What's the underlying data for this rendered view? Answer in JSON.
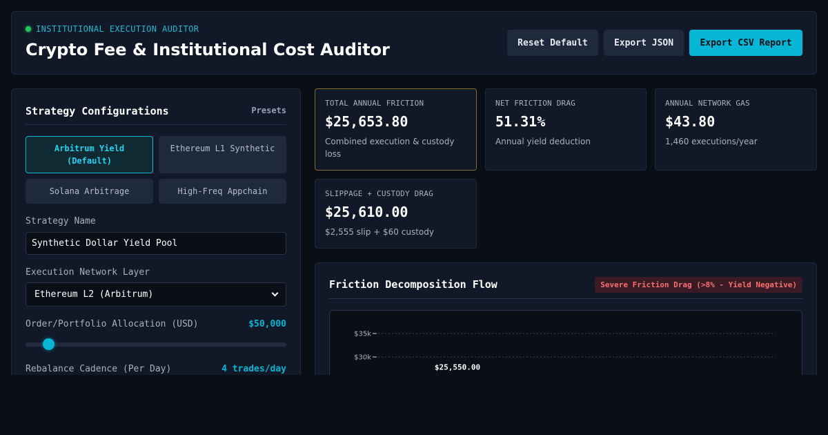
{
  "header": {
    "eyebrow": "INSTITUTIONAL EXECUTION AUDITOR",
    "title": "Crypto Fee & Institutional Cost Auditor",
    "buttons": {
      "reset": "Reset Default",
      "export_json": "Export JSON",
      "export_csv": "Export CSV Report"
    }
  },
  "config": {
    "title": "Strategy Configurations",
    "presets_label": "Presets",
    "presets": [
      {
        "label": "Arbitrum Yield (Default)",
        "active": true
      },
      {
        "label": "Ethereum L1 Synthetic",
        "active": false
      },
      {
        "label": "Solana Arbitrage",
        "active": false
      },
      {
        "label": "High-Freq Appchain",
        "active": false
      }
    ],
    "strategy_name_label": "Strategy Name",
    "strategy_name_value": "Synthetic Dollar Yield Pool",
    "network_label": "Execution Network Layer",
    "network_value": "Ethereum L2 (Arbitrum)",
    "allocation_label": "Order/Portfolio Allocation (USD)",
    "allocation_value": "$50,000",
    "allocation_fraction": 0.07,
    "cadence_label": "Rebalance Cadence (Per Day)",
    "cadence_value": "4 trades/day"
  },
  "metrics": [
    {
      "label": "TOTAL ANNUAL FRICTION",
      "value": "$25,653.80",
      "sub": "Combined execution & custody loss",
      "highlight": true
    },
    {
      "label": "NET FRICTION DRAG",
      "value": "51.31%",
      "sub": "Annual yield deduction",
      "highlight": false
    },
    {
      "label": "ANNUAL NETWORK GAS",
      "value": "$43.80",
      "sub": "1,460 executions/year",
      "highlight": false
    },
    {
      "label": "SLIPPAGE + CUSTODY DRAG",
      "value": "$25,610.00",
      "sub": "$2,555 slip + $60 custody",
      "highlight": false
    }
  ],
  "flow": {
    "title": "Friction Decomposition Flow",
    "badge": "Severe Friction Drag (>8% - Yield Negative)",
    "badge_color": "#f87171"
  },
  "chart_data": {
    "type": "bar",
    "y_ticks": [
      "$35k",
      "$30k"
    ],
    "y_tick_values": [
      35000,
      30000
    ],
    "data_labels": [
      "$25,550.00"
    ],
    "values": [
      25550
    ],
    "grid": true
  }
}
